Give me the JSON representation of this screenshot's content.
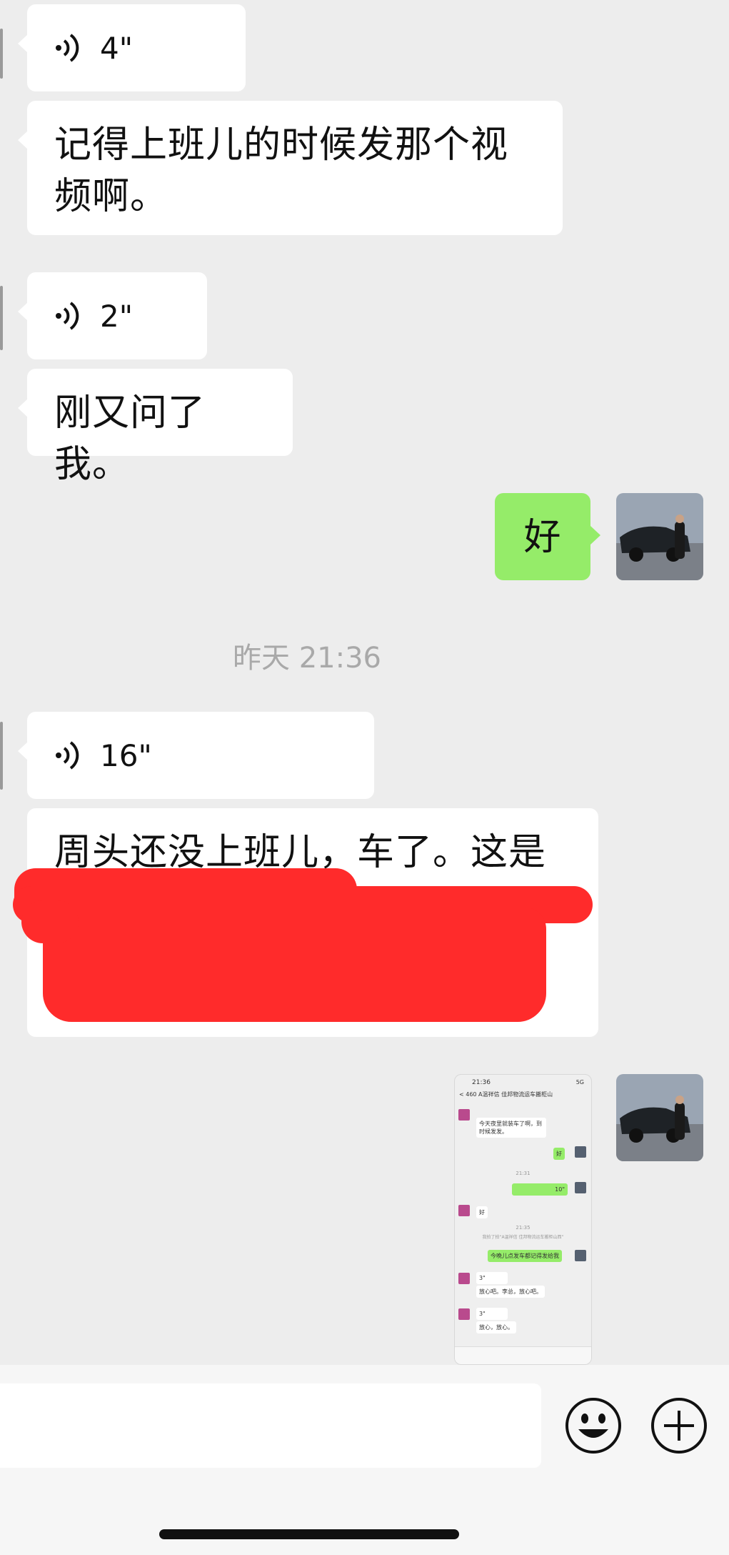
{
  "messages": {
    "m1": {
      "duration": "4\""
    },
    "m2": {
      "text": "记得上班儿的时候发那个视频啊。"
    },
    "m3": {
      "duration": "2\""
    },
    "m4": {
      "text": "刚又问了我。"
    },
    "m5": {
      "text": "好"
    },
    "timestamp": "昨天 21:36",
    "m6": {
      "duration": "16\""
    },
    "m7": {
      "text": "周头还没上班儿，车了。这是斌"
    }
  },
  "screenshot_preview": {
    "status_time": "21:36",
    "status_right": "5G",
    "header": "< 460  A温祥信 佳邦物流运车搬柜山",
    "rows": {
      "r1": "今天夜里就装车了啊，到时候发发。",
      "r2": "好",
      "t1": "21:31",
      "r3": "10\"",
      "r4": "好",
      "t2": "21:35",
      "r5": "我拍了拍“A温祥信 佳邦物流运车搬柜山西”",
      "r6": "今晚儿点发车都记得发给我",
      "r7": "3\"",
      "r8": "放心吧。李总，放心吧。",
      "r9": "3\"",
      "r10": "放心，放心。"
    }
  },
  "icons": {
    "emoji": "emoji-icon",
    "add": "plus-icon",
    "voice": "voice-wave-icon"
  },
  "colors": {
    "background": "#ededed",
    "bubble_in": "#ffffff",
    "bubble_out": "#95ec69",
    "redaction": "#ff2b2b"
  }
}
